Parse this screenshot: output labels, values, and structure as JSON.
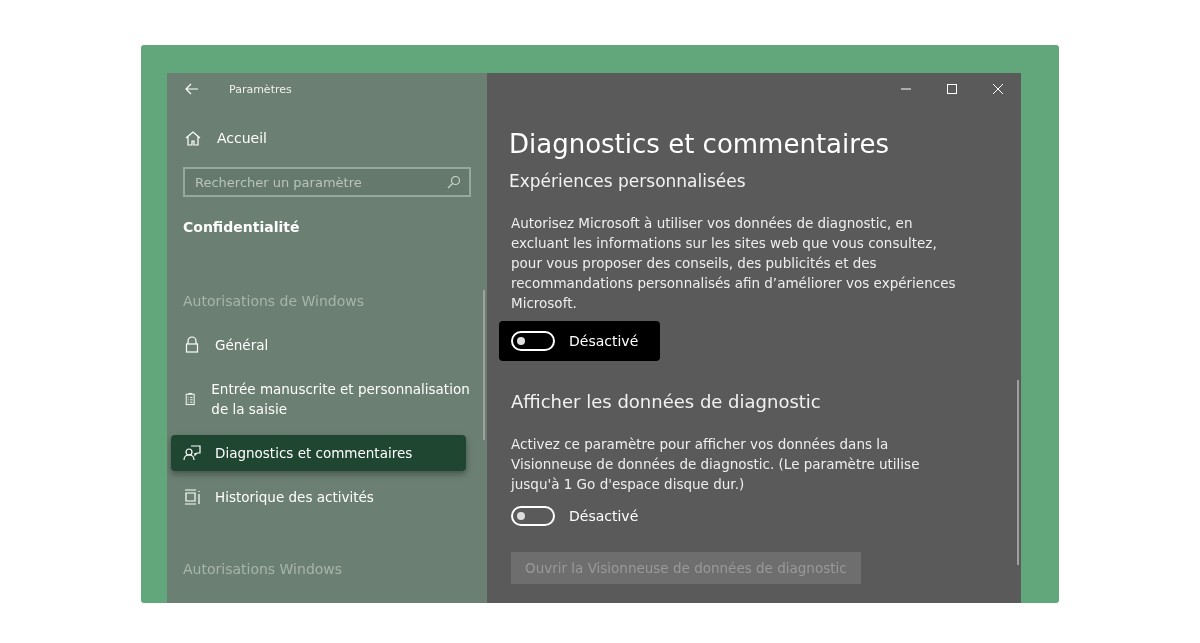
{
  "window": {
    "title": "Paramètres"
  },
  "sidebar": {
    "home": "Accueil",
    "search": {
      "placeholder": "Rechercher un paramètre"
    },
    "category": "Confidentialité",
    "sections": [
      {
        "heading": "Autorisations de Windows",
        "items": [
          {
            "label": "Général",
            "kind": "lock",
            "selected": false
          },
          {
            "label": "Entrée manuscrite et personnalisation de la saisie",
            "kind": "clipboard",
            "selected": false
          },
          {
            "label": "Diagnostics et commentaires",
            "kind": "feedback",
            "selected": true
          },
          {
            "label": "Historique des activités",
            "kind": "timeline",
            "selected": false
          }
        ]
      },
      {
        "heading": "Autorisations Windows"
      }
    ]
  },
  "content": {
    "title": "Diagnostics et commentaires",
    "groups": [
      {
        "heading": "Expériences personnalisées",
        "description": "Autorisez Microsoft à utiliser vos données de diagnostic, en excluant les informations sur les sites web que vous consultez, pour vous proposer des conseils, des publicités et des recommandations personnalisés afin d’améliorer vos expériences Microsoft.",
        "toggle": {
          "on": false,
          "label": "Désactivé",
          "highlighted": true
        }
      },
      {
        "heading": "Afficher les données de diagnostic",
        "description": "Activez ce paramètre pour afficher vos données dans la Visionneuse de données de diagnostic. (Le paramètre utilise jusqu'à 1 Go d'espace disque dur.)",
        "toggle": {
          "on": false,
          "label": "Désactivé",
          "highlighted": false
        },
        "button": {
          "label": "Ouvrir la Visionneuse de données de diagnostic",
          "disabled": true
        }
      }
    ]
  }
}
